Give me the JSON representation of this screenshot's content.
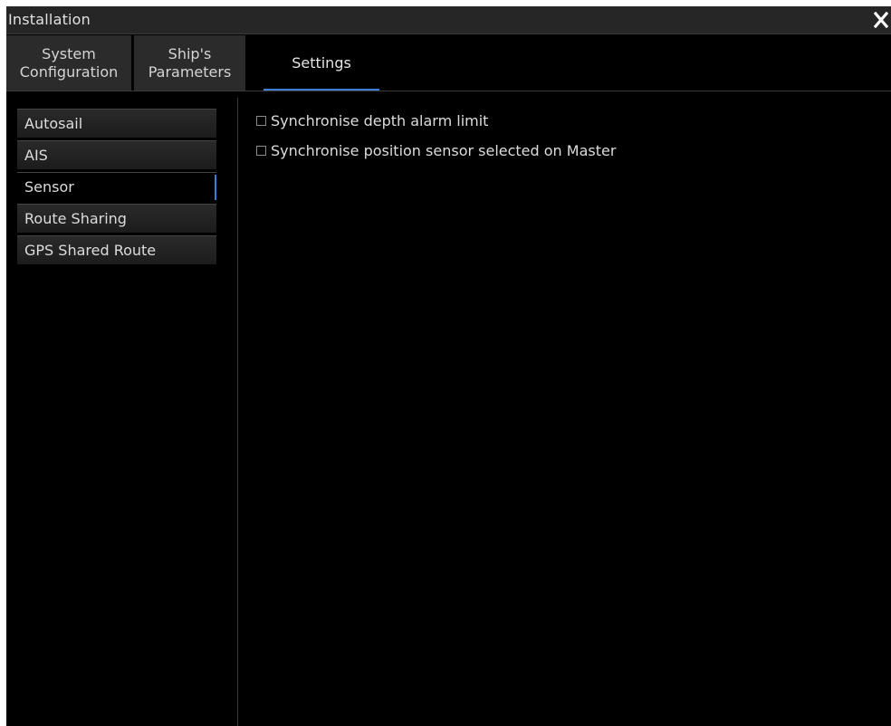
{
  "window": {
    "title": "Installation"
  },
  "icons": {
    "close": "close-icon"
  },
  "tabs": [
    {
      "line1": "System",
      "line2": "Configuration",
      "active": false
    },
    {
      "line1": "Ship's",
      "line2": "Parameters",
      "active": false
    },
    {
      "label": "Settings",
      "active": true
    }
  ],
  "sidebar": {
    "items": [
      {
        "label": "Autosail",
        "selected": false
      },
      {
        "label": "AIS",
        "selected": false
      },
      {
        "label": "Sensor",
        "selected": true
      },
      {
        "label": "Route Sharing",
        "selected": false
      },
      {
        "label": "GPS Shared Route",
        "selected": false
      }
    ]
  },
  "options": [
    {
      "label": "Synchronise depth alarm limit",
      "checked": false
    },
    {
      "label": "Synchronise position sensor selected on Master",
      "checked": false
    }
  ],
  "colors": {
    "accent": "#3d7fd6",
    "background": "#000000",
    "panel": "#2b2b2b"
  }
}
